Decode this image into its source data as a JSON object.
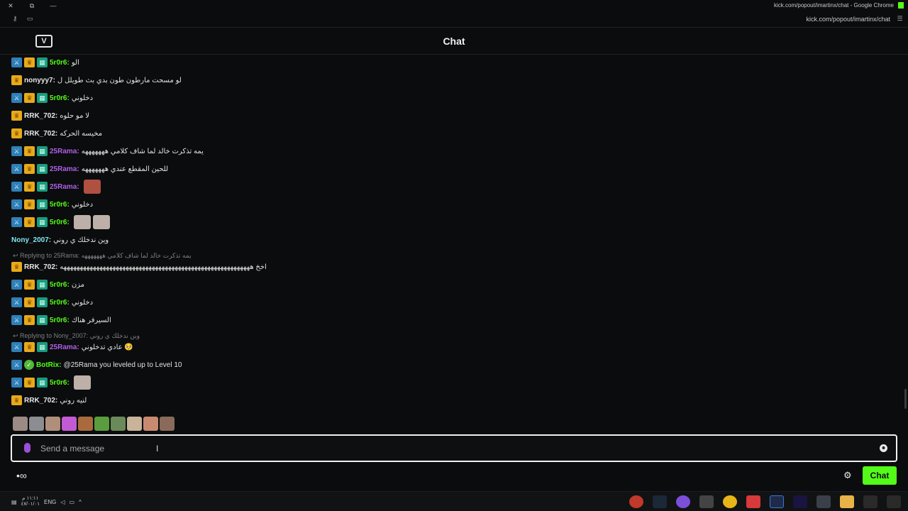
{
  "browser": {
    "window_title": "kick.com/popout/imartinx/chat - Google Chrome",
    "url": "kick.com/popout/imartinx/chat",
    "controls": [
      "✕",
      "⧉",
      "—"
    ]
  },
  "header": {
    "logo_text": "V",
    "title": "Chat"
  },
  "colors": {
    "accent": "#53fc18",
    "mod_badge": "#2f7fb7",
    "vip_badge": "#e8a91a",
    "sub_badge": "#1a9c7d",
    "bot_badge": "#53b938"
  },
  "messages": [
    {
      "badges": [
        "mod",
        "vip",
        "sub"
      ],
      "user": "5r0r6:",
      "user_color": "#53fc18",
      "text": "الو"
    },
    {
      "badges": [
        "vip"
      ],
      "user": "nonyyy7:",
      "user_color": "#e6e6e6",
      "text": "لو مسحت مارطون طون بدي بث طويلل ل"
    },
    {
      "badges": [
        "mod",
        "vip",
        "sub"
      ],
      "user": "5r0r6:",
      "user_color": "#53fc18",
      "text": "دخلوني"
    },
    {
      "badges": [
        "vip"
      ],
      "user": "RRK_702:",
      "user_color": "#e6e6e6",
      "text": "لا مو حلوه"
    },
    {
      "badges": [
        "vip"
      ],
      "user": "RRK_702:",
      "user_color": "#e6e6e6",
      "text": "مخيسه الحركه"
    },
    {
      "badges": [
        "mod",
        "vip",
        "sub"
      ],
      "user": "25Rama:",
      "user_color": "#b05fe8",
      "text": "يمه تذكرت خالد لما شاف كلامي هههههههه"
    },
    {
      "badges": [
        "mod",
        "vip",
        "sub"
      ],
      "user": "25Rama:",
      "user_color": "#b05fe8",
      "text": "للحين المقطع عندي هههههههه"
    },
    {
      "badges": [
        "mod",
        "vip",
        "sub"
      ],
      "user": "25Rama:",
      "user_color": "#b05fe8",
      "text": ""
    },
    {
      "badges": [
        "mod",
        "vip",
        "sub"
      ],
      "user": "5r0r6:",
      "user_color": "#53fc18",
      "text": "دخلوني"
    },
    {
      "badges": [
        "mod",
        "vip",
        "sub"
      ],
      "user": "5r0r6:",
      "user_color": "#53fc18",
      "text": ""
    },
    {
      "badges": [],
      "user": "Nony_2007:",
      "user_color": "#7fe7f0",
      "text": "وين ندخلك ي روني"
    },
    {
      "badges": [
        "vip"
      ],
      "user": "RRK_702:",
      "user_color": "#e6e6e6",
      "text": "اخخ ههههههههههههههههههههههههههههههههههههههههههههههههههههههههههه"
    },
    {
      "badges": [
        "mod",
        "vip",
        "sub"
      ],
      "user": "5r0r6:",
      "user_color": "#53fc18",
      "text": "مزن"
    },
    {
      "badges": [
        "mod",
        "vip",
        "sub"
      ],
      "user": "5r0r6:",
      "user_color": "#53fc18",
      "text": "دخلوني"
    },
    {
      "badges": [
        "mod",
        "vip",
        "sub"
      ],
      "user": "5r0r6:",
      "user_color": "#53fc18",
      "text": "السيرفر هناك"
    },
    {
      "badges": [
        "mod",
        "vip",
        "sub"
      ],
      "user": "25Rama:",
      "user_color": "#b05fe8",
      "text": "عادي تدخلوني 🥺"
    },
    {
      "badges": [
        "mod",
        "bot"
      ],
      "user": "BotRix:",
      "user_color": "#53fc18",
      "text": "@25Rama you leveled up to Level 10"
    },
    {
      "badges": [
        "mod",
        "vip",
        "sub"
      ],
      "user": "5r0r6:",
      "user_color": "#53fc18",
      "text": ""
    },
    {
      "badges": [
        "vip"
      ],
      "user": "RRK_702:",
      "user_color": "#e6e6e6",
      "text": "لنيه روني"
    }
  ],
  "replies": [
    {
      "text": "↩ Replying to 25Rama: يمه تذكرت خالد لما شاف كلامي هههههههه"
    },
    {
      "text": "↩ Replying to Nony_2007: وين ندخلك ي روني"
    }
  ],
  "input": {
    "placeholder": "Send a message"
  },
  "bottom": {
    "points_icon": "•∞",
    "gear_icon": "⚙",
    "send_label": "Chat"
  },
  "taskbar": {
    "lang": "ENG",
    "time": "١١:١١ م",
    "date": "٤٧/٠١/٠١"
  }
}
